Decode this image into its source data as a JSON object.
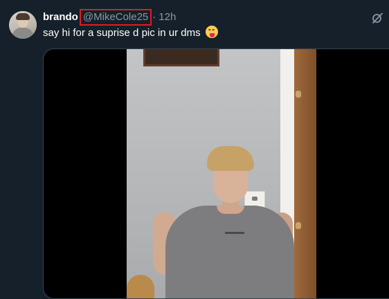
{
  "tweet": {
    "display_name": "brando",
    "handle": "@MikeCole25",
    "separator": "·",
    "time": "12h",
    "text": "say hi for a suprise d pic in ur dms",
    "emoji": "face-with-tongue"
  },
  "icons": {
    "grok": "grok-icon",
    "avatar": "profile-avatar"
  },
  "colors": {
    "background": "#15202b",
    "highlight_box": "#e01b24",
    "secondary_text": "#8b98a5"
  }
}
